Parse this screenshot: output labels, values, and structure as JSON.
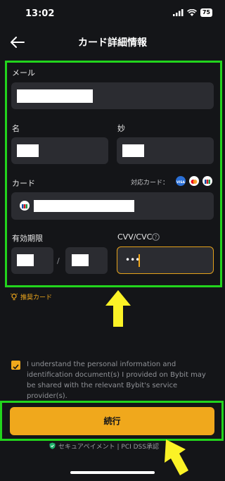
{
  "status_bar": {
    "time": "13:02",
    "battery": "75"
  },
  "header": {
    "title": "カード詳細情報"
  },
  "form": {
    "email_label": "メール",
    "first_name_label": "名",
    "last_name_label": "妙",
    "card_label": "カード",
    "supported_cards_label": "対応カード：",
    "supported_cards": [
      "visa-icon",
      "mastercard-icon",
      "jcb-icon"
    ],
    "expiry_label": "有効期限",
    "expiry_separator": "/",
    "cvv_label": "CVV/CVC",
    "cvv_value": "•••"
  },
  "recommended_card": "推奨カード",
  "consent": {
    "checked": true,
    "text": "I understand the personal information and identification document(s) I provided on Bybit may be shared with the relevant Bybit's service provider(s)."
  },
  "continue_button": "続行",
  "secure_note": "セキュアペイメント | PCI DSS承認",
  "colors": {
    "accent": "#f0a81c",
    "highlight": "#22d41d",
    "background": "#141518",
    "field": "#2b2c31"
  }
}
